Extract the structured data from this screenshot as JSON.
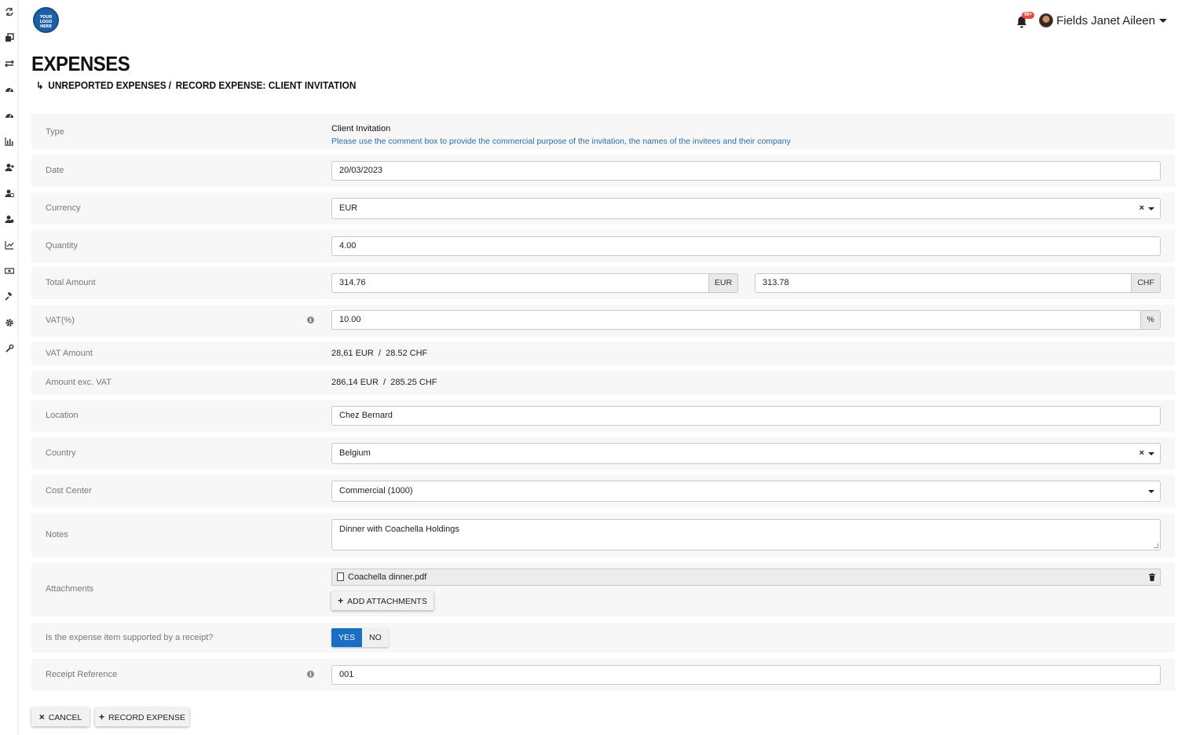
{
  "sidebar": {
    "icons": [
      "transfer-icon",
      "windows-icon",
      "exchange-icon",
      "dashboard-icon",
      "dashboard-icon",
      "bar-chart-icon",
      "user-plus-icon",
      "user-clock-icon",
      "user-gear-icon",
      "line-chart-icon",
      "money-icon",
      "gavel-icon",
      "gear-icon",
      "wrench-icon"
    ]
  },
  "header": {
    "logo_text": "YOUR LOGO HERE",
    "notification_badge": "99+",
    "user_name": "Fields Janet Aileen"
  },
  "page": {
    "title": "EXPENSES",
    "breadcrumb": [
      "UNREPORTED EXPENSES",
      "RECORD EXPENSE: CLIENT INVITATION"
    ],
    "breadcrumb_sep": "/"
  },
  "form": {
    "type": {
      "label": "Type",
      "value": "Client Invitation",
      "help": "Please use the comment box to provide the commercial purpose of the invitation, the names of the invitees and their company"
    },
    "date": {
      "label": "Date",
      "value": "20/03/2023"
    },
    "currency": {
      "label": "Currency",
      "value": "EUR",
      "clear": "×"
    },
    "quantity": {
      "label": "Quantity",
      "value": "4.00"
    },
    "total_amount": {
      "label": "Total Amount",
      "value_eur": "314.76",
      "unit_eur": "EUR",
      "value_chf": "313.78",
      "unit_chf": "CHF"
    },
    "vat_percent": {
      "label": "VAT(%)",
      "value": "10.00",
      "unit": "%"
    },
    "vat_amount": {
      "label": "VAT Amount",
      "value": "28,61 EUR  /  28.52 CHF"
    },
    "amount_exc_vat": {
      "label": "Amount exc. VAT",
      "value": "286,14 EUR  /  285.25 CHF"
    },
    "location": {
      "label": "Location",
      "value": "Chez Bernard"
    },
    "country": {
      "label": "Country",
      "value": "Belgium",
      "clear": "×"
    },
    "cost_center": {
      "label": "Cost Center",
      "value": "Commercial (1000)"
    },
    "notes": {
      "label": "Notes",
      "value": "Dinner with Coachella Holdings"
    },
    "attachments": {
      "label": "Attachments",
      "file_name": "Coachella dinner.pdf",
      "add_label": "ADD ATTACHMENTS"
    },
    "receipt_supported": {
      "label": "Is the expense item supported by a receipt?",
      "yes": "YES",
      "no": "NO",
      "selected": "YES"
    },
    "receipt_reference": {
      "label": "Receipt Reference",
      "value": "001"
    }
  },
  "actions": {
    "cancel_label": "CANCEL",
    "record_label": "RECORD EXPENSE"
  },
  "colors": {
    "accent": "#1a6fc4",
    "help_text": "#2e6da4",
    "row_bg": "#f7f7f7",
    "badge": "#e74c3c"
  }
}
